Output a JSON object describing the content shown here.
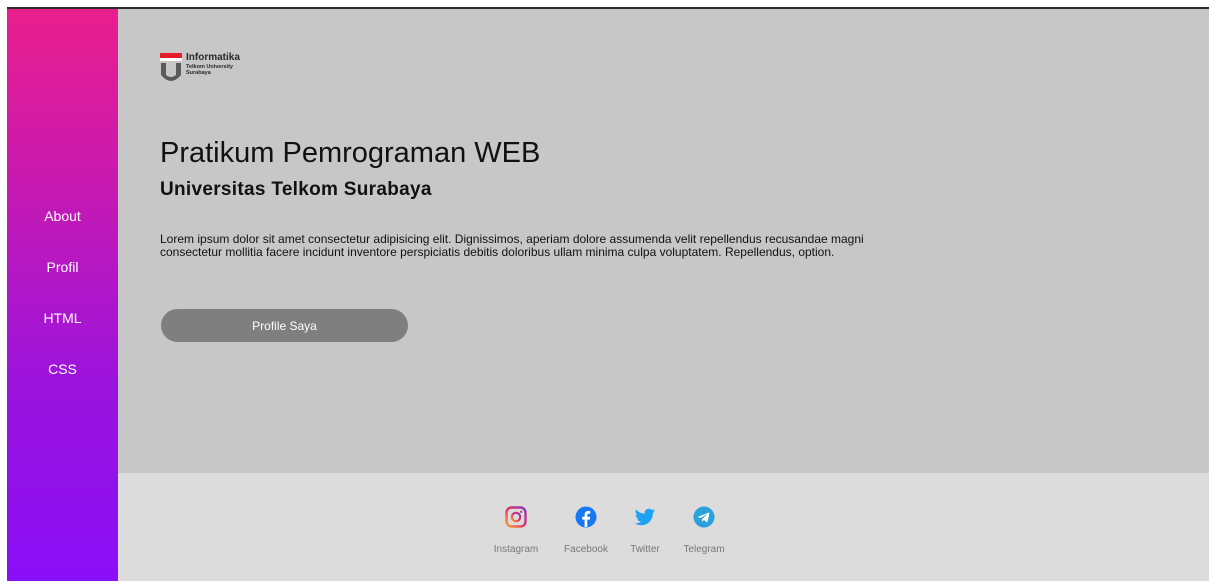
{
  "logo": {
    "title": "Informatika",
    "line1": "Telkom University",
    "line2": "Surabaya"
  },
  "nav": {
    "items": [
      "About",
      "Profil",
      "HTML",
      "CSS"
    ]
  },
  "hero": {
    "title": "Pratikum Pemrograman WEB",
    "subtitle": "Universitas Telkom Surabaya",
    "description": "Lorem ipsum dolor sit amet consectetur adipisicing elit. Dignissimos, aperiam dolore assumenda velit repellendus recusandae magni consectetur mollitia facere incidunt inventore perspiciatis debitis doloribus ullam minima culpa voluptatem. Repellendus, option.",
    "button_label": "Profile Saya"
  },
  "footer": {
    "social": [
      {
        "label": "Instagram",
        "icon": "instagram-icon"
      },
      {
        "label": "Facebook",
        "icon": "facebook-icon"
      },
      {
        "label": "Twitter",
        "icon": "twitter-icon"
      },
      {
        "label": "Telegram",
        "icon": "telegram-icon"
      }
    ]
  },
  "colors": {
    "sidebar_top": "#e91e8c",
    "sidebar_bottom": "#8a0ff7",
    "main_bg": "#c7c7c7",
    "footer_bg": "#dcdcdc",
    "button_bg": "#7f7f7f",
    "facebook": "#1877f2",
    "twitter": "#1da1f2",
    "telegram": "#2aa1da"
  }
}
